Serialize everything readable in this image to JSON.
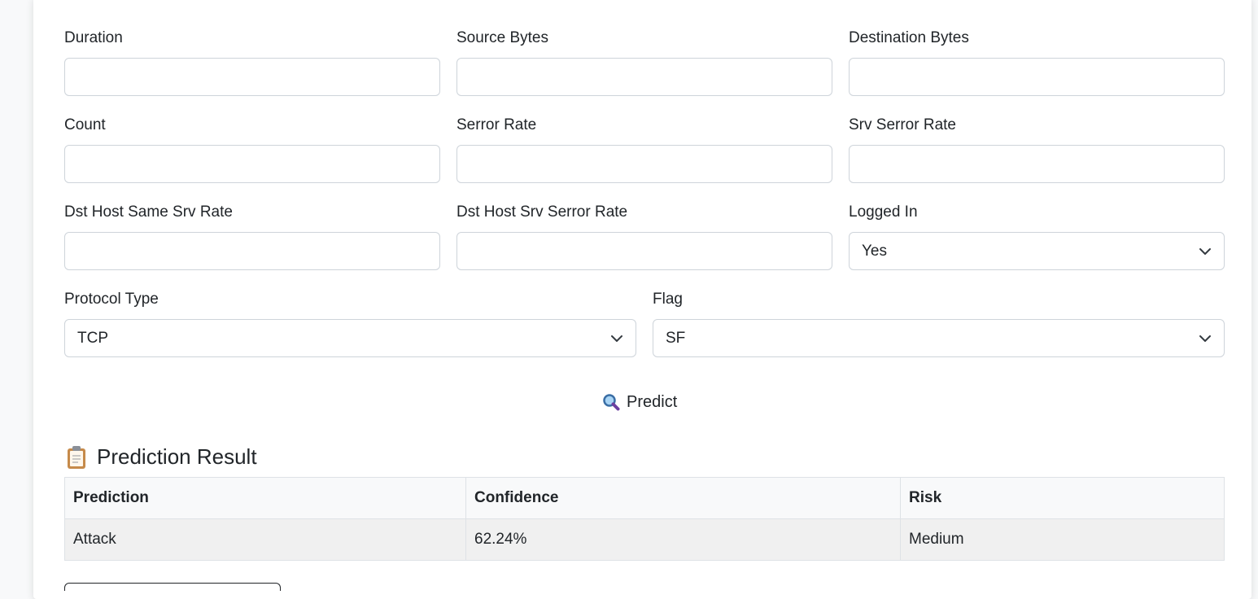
{
  "form": {
    "row1": [
      {
        "label": "Duration",
        "value": "",
        "placeholder": ""
      },
      {
        "label": "Source Bytes",
        "value": "",
        "placeholder": ""
      },
      {
        "label": "Destination Bytes",
        "value": "",
        "placeholder": ""
      }
    ],
    "row2": [
      {
        "label": "Count",
        "value": "",
        "placeholder": ""
      },
      {
        "label": "Serror Rate",
        "value": "",
        "placeholder": ""
      },
      {
        "label": "Srv Serror Rate",
        "value": "",
        "placeholder": ""
      }
    ],
    "row3": [
      {
        "label": "Dst Host Same Srv Rate",
        "value": "",
        "placeholder": ""
      },
      {
        "label": "Dst Host Srv Serror Rate",
        "value": "",
        "placeholder": ""
      },
      {
        "label": "Logged In",
        "selected": "Yes"
      }
    ],
    "row4": [
      {
        "label": "Protocol Type",
        "selected": "TCP"
      },
      {
        "label": "Flag",
        "selected": "SF"
      }
    ]
  },
  "predict_button": {
    "icon": "magnifier-icon",
    "label": "Predict"
  },
  "result": {
    "icon": "clipboard-icon",
    "title": "Prediction Result",
    "columns": [
      "Prediction",
      "Confidence",
      "Risk"
    ],
    "rows": [
      [
        "Attack",
        "62.24%",
        "Medium"
      ]
    ]
  },
  "colors": {
    "border": "#ced4da",
    "header_bg": "#f8f9fa",
    "row_bg": "#f0f0f0"
  }
}
